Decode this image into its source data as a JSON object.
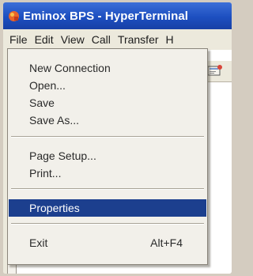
{
  "window": {
    "title": "Eminox BPS - HyperTerminal"
  },
  "menubar": {
    "items": [
      {
        "label": "File"
      },
      {
        "label": "Edit"
      },
      {
        "label": "View"
      },
      {
        "label": "Call"
      },
      {
        "label": "Transfer"
      },
      {
        "label": "H"
      }
    ]
  },
  "file_menu": {
    "new_connection": "New Connection",
    "open": "Open...",
    "save": "Save",
    "save_as": "Save As...",
    "page_setup": "Page Setup...",
    "print": "Print...",
    "properties": "Properties",
    "exit": "Exit",
    "exit_shortcut": "Alt+F4",
    "selected_item": "Properties"
  },
  "colors": {
    "title_bar": "#1d4fc0",
    "highlight": "#1c3f8e",
    "menu_background": "#f2f0ea"
  },
  "icons": {
    "app": "hyperterminal-app-icon",
    "toolbar": "properties-toolbar-icon"
  }
}
